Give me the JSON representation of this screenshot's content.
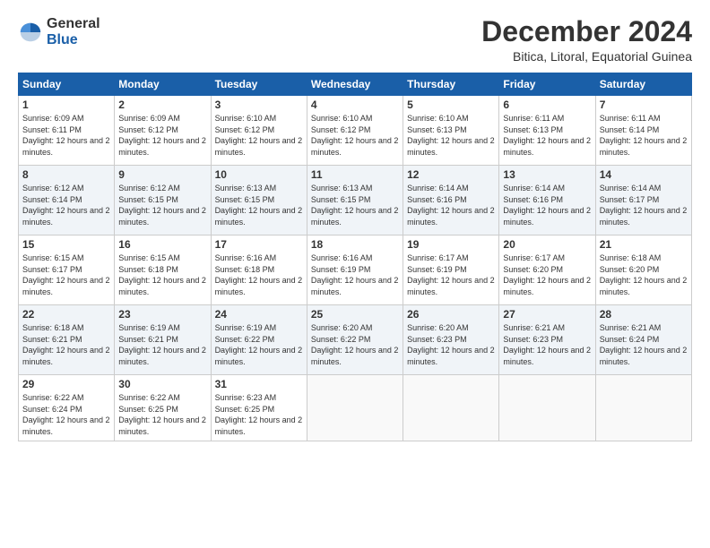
{
  "logo": {
    "general": "General",
    "blue": "Blue"
  },
  "title": "December 2024",
  "subtitle": "Bitica, Litoral, Equatorial Guinea",
  "days_header": [
    "Sunday",
    "Monday",
    "Tuesday",
    "Wednesday",
    "Thursday",
    "Friday",
    "Saturday"
  ],
  "weeks": [
    [
      {
        "num": "1",
        "rise": "6:09 AM",
        "set": "6:11 PM",
        "daylight": "12 hours and 2 minutes."
      },
      {
        "num": "2",
        "rise": "6:09 AM",
        "set": "6:12 PM",
        "daylight": "12 hours and 2 minutes."
      },
      {
        "num": "3",
        "rise": "6:10 AM",
        "set": "6:12 PM",
        "daylight": "12 hours and 2 minutes."
      },
      {
        "num": "4",
        "rise": "6:10 AM",
        "set": "6:12 PM",
        "daylight": "12 hours and 2 minutes."
      },
      {
        "num": "5",
        "rise": "6:10 AM",
        "set": "6:13 PM",
        "daylight": "12 hours and 2 minutes."
      },
      {
        "num": "6",
        "rise": "6:11 AM",
        "set": "6:13 PM",
        "daylight": "12 hours and 2 minutes."
      },
      {
        "num": "7",
        "rise": "6:11 AM",
        "set": "6:14 PM",
        "daylight": "12 hours and 2 minutes."
      }
    ],
    [
      {
        "num": "8",
        "rise": "6:12 AM",
        "set": "6:14 PM",
        "daylight": "12 hours and 2 minutes."
      },
      {
        "num": "9",
        "rise": "6:12 AM",
        "set": "6:15 PM",
        "daylight": "12 hours and 2 minutes."
      },
      {
        "num": "10",
        "rise": "6:13 AM",
        "set": "6:15 PM",
        "daylight": "12 hours and 2 minutes."
      },
      {
        "num": "11",
        "rise": "6:13 AM",
        "set": "6:15 PM",
        "daylight": "12 hours and 2 minutes."
      },
      {
        "num": "12",
        "rise": "6:14 AM",
        "set": "6:16 PM",
        "daylight": "12 hours and 2 minutes."
      },
      {
        "num": "13",
        "rise": "6:14 AM",
        "set": "6:16 PM",
        "daylight": "12 hours and 2 minutes."
      },
      {
        "num": "14",
        "rise": "6:14 AM",
        "set": "6:17 PM",
        "daylight": "12 hours and 2 minutes."
      }
    ],
    [
      {
        "num": "15",
        "rise": "6:15 AM",
        "set": "6:17 PM",
        "daylight": "12 hours and 2 minutes."
      },
      {
        "num": "16",
        "rise": "6:15 AM",
        "set": "6:18 PM",
        "daylight": "12 hours and 2 minutes."
      },
      {
        "num": "17",
        "rise": "6:16 AM",
        "set": "6:18 PM",
        "daylight": "12 hours and 2 minutes."
      },
      {
        "num": "18",
        "rise": "6:16 AM",
        "set": "6:19 PM",
        "daylight": "12 hours and 2 minutes."
      },
      {
        "num": "19",
        "rise": "6:17 AM",
        "set": "6:19 PM",
        "daylight": "12 hours and 2 minutes."
      },
      {
        "num": "20",
        "rise": "6:17 AM",
        "set": "6:20 PM",
        "daylight": "12 hours and 2 minutes."
      },
      {
        "num": "21",
        "rise": "6:18 AM",
        "set": "6:20 PM",
        "daylight": "12 hours and 2 minutes."
      }
    ],
    [
      {
        "num": "22",
        "rise": "6:18 AM",
        "set": "6:21 PM",
        "daylight": "12 hours and 2 minutes."
      },
      {
        "num": "23",
        "rise": "6:19 AM",
        "set": "6:21 PM",
        "daylight": "12 hours and 2 minutes."
      },
      {
        "num": "24",
        "rise": "6:19 AM",
        "set": "6:22 PM",
        "daylight": "12 hours and 2 minutes."
      },
      {
        "num": "25",
        "rise": "6:20 AM",
        "set": "6:22 PM",
        "daylight": "12 hours and 2 minutes."
      },
      {
        "num": "26",
        "rise": "6:20 AM",
        "set": "6:23 PM",
        "daylight": "12 hours and 2 minutes."
      },
      {
        "num": "27",
        "rise": "6:21 AM",
        "set": "6:23 PM",
        "daylight": "12 hours and 2 minutes."
      },
      {
        "num": "28",
        "rise": "6:21 AM",
        "set": "6:24 PM",
        "daylight": "12 hours and 2 minutes."
      }
    ],
    [
      {
        "num": "29",
        "rise": "6:22 AM",
        "set": "6:24 PM",
        "daylight": "12 hours and 2 minutes."
      },
      {
        "num": "30",
        "rise": "6:22 AM",
        "set": "6:25 PM",
        "daylight": "12 hours and 2 minutes."
      },
      {
        "num": "31",
        "rise": "6:23 AM",
        "set": "6:25 PM",
        "daylight": "12 hours and 2 minutes."
      },
      null,
      null,
      null,
      null
    ]
  ]
}
